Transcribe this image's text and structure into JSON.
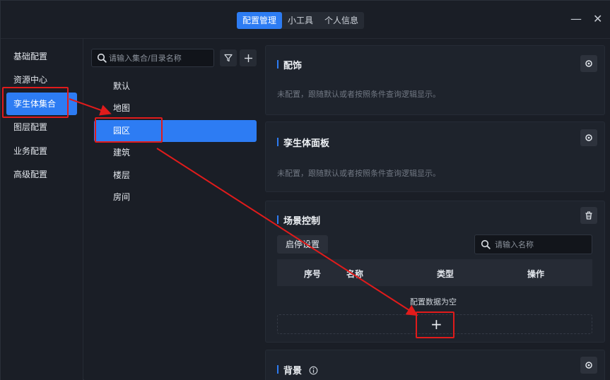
{
  "header": {
    "tabs": [
      {
        "label": "配置管理",
        "active": true
      },
      {
        "label": "小工具",
        "active": false
      },
      {
        "label": "个人信息",
        "active": false
      }
    ],
    "minimize_icon": "minimize-icon",
    "close_icon": "close-icon"
  },
  "left_nav": {
    "items": [
      {
        "label": "基础配置"
      },
      {
        "label": "资源中心"
      },
      {
        "label": "孪生体集合",
        "active": true
      },
      {
        "label": "图层配置"
      },
      {
        "label": "业务配置"
      },
      {
        "label": "高级配置"
      }
    ]
  },
  "collection": {
    "search_placeholder": "请输入集合/目录名称",
    "filter_icon": "filter-icon",
    "add_icon": "plus-icon",
    "items": [
      {
        "label": "默认"
      },
      {
        "label": "地图"
      },
      {
        "label": "园区",
        "active": true
      },
      {
        "label": "建筑"
      },
      {
        "label": "楼层"
      },
      {
        "label": "房间"
      }
    ]
  },
  "panels": {
    "decor": {
      "title": "配饰",
      "desc": "未配置，跟随默认或者按照条件查询逻辑显示。",
      "button_icon": "settings-icon"
    },
    "twin_panel": {
      "title": "孪生体面板",
      "desc": "未配置，跟随默认或者按照条件查询逻辑显示。",
      "button_icon": "settings-icon"
    },
    "scene_control": {
      "title": "场景控制",
      "button_icon": "trash-icon",
      "scene_settings_label": "启停设置",
      "search_placeholder": "请输入名称",
      "columns": [
        "序号",
        "名称",
        "类型",
        "操作"
      ],
      "empty_text": "配置数据为空",
      "add_symbol": "+"
    },
    "background": {
      "title": "背景",
      "info_icon": "info-icon",
      "button_icon": "settings-icon"
    }
  },
  "colors": {
    "accent": "#2d7cf3",
    "annotation": "#e11b1b",
    "background": "#1a1e26"
  }
}
